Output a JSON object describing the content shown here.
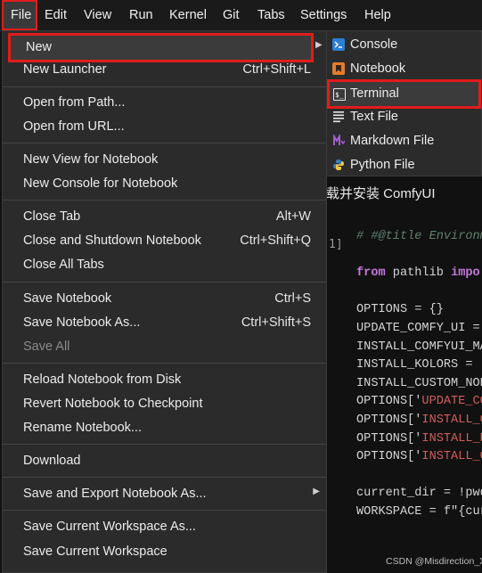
{
  "menubar": {
    "items": [
      "File",
      "Edit",
      "View",
      "Run",
      "Kernel",
      "Git",
      "Tabs",
      "Settings",
      "Help"
    ],
    "active": "File"
  },
  "file_menu": {
    "new": "New",
    "new_launcher": {
      "label": "New Launcher",
      "shortcut": "Ctrl+Shift+L"
    },
    "open_from_path": "Open from Path...",
    "open_from_url": "Open from URL...",
    "new_view": "New View for Notebook",
    "new_console": "New Console for Notebook",
    "close_tab": {
      "label": "Close Tab",
      "shortcut": "Alt+W"
    },
    "close_shutdown": {
      "label": "Close and Shutdown Notebook",
      "shortcut": "Ctrl+Shift+Q"
    },
    "close_all": "Close All Tabs",
    "save_notebook": {
      "label": "Save Notebook",
      "shortcut": "Ctrl+S"
    },
    "save_as": {
      "label": "Save Notebook As...",
      "shortcut": "Ctrl+Shift+S"
    },
    "save_all": "Save All",
    "reload": "Reload Notebook from Disk",
    "revert": "Revert Notebook to Checkpoint",
    "rename": "Rename Notebook...",
    "download": "Download",
    "save_export": "Save and Export Notebook As...",
    "save_workspace_as": "Save Current Workspace As...",
    "save_workspace": "Save Current Workspace"
  },
  "new_submenu": {
    "console": "Console",
    "notebook": "Notebook",
    "terminal": "Terminal",
    "text_file": "Text File",
    "markdown_file": "Markdown File",
    "python_file": "Python File"
  },
  "notebook": {
    "heading": "载并安装 ComfyUI",
    "prompt": "1]",
    "code": [
      [
        {
          "t": "# #@title Environme",
          "c": "c-comment"
        }
      ],
      [],
      [
        {
          "t": "from",
          "c": "c-kw"
        },
        {
          "t": " pathlib ",
          "c": "c-plain"
        },
        {
          "t": "impo",
          "c": "c-kw"
        }
      ],
      [],
      [
        {
          "t": "OPTIONS = {}",
          "c": "c-plain"
        }
      ],
      [
        {
          "t": "UPDATE_COMFY_UI = ",
          "c": "c-plain"
        }
      ],
      [
        {
          "t": "INSTALL_COMFYUI_MA",
          "c": "c-plain"
        }
      ],
      [
        {
          "t": "INSTALL_KOLORS = ",
          "c": "c-plain"
        },
        {
          "t": "'",
          "c": "c-str"
        }
      ],
      [
        {
          "t": "INSTALL_CUSTOM_NOD",
          "c": "c-plain"
        }
      ],
      [
        {
          "t": "OPTIONS['",
          "c": "c-plain"
        },
        {
          "t": "UPDATE_CO",
          "c": "c-str"
        }
      ],
      [
        {
          "t": "OPTIONS['",
          "c": "c-plain"
        },
        {
          "t": "INSTALL_C",
          "c": "c-str"
        }
      ],
      [
        {
          "t": "OPTIONS['",
          "c": "c-plain"
        },
        {
          "t": "INSTALL_K",
          "c": "c-str"
        }
      ],
      [
        {
          "t": "OPTIONS['",
          "c": "c-plain"
        },
        {
          "t": "INSTALL_C",
          "c": "c-str"
        }
      ],
      [],
      [
        {
          "t": "current_dir = !pwd",
          "c": "c-plain"
        }
      ],
      [
        {
          "t": "WORKSPACE = f\"{cur",
          "c": "c-plain"
        }
      ]
    ]
  },
  "watermark": "CSDN @Misdirection_XG",
  "colors": {
    "highlight_border": "#e01c1c",
    "menu_bg": "#2b2b2b",
    "page_bg": "#111111"
  }
}
